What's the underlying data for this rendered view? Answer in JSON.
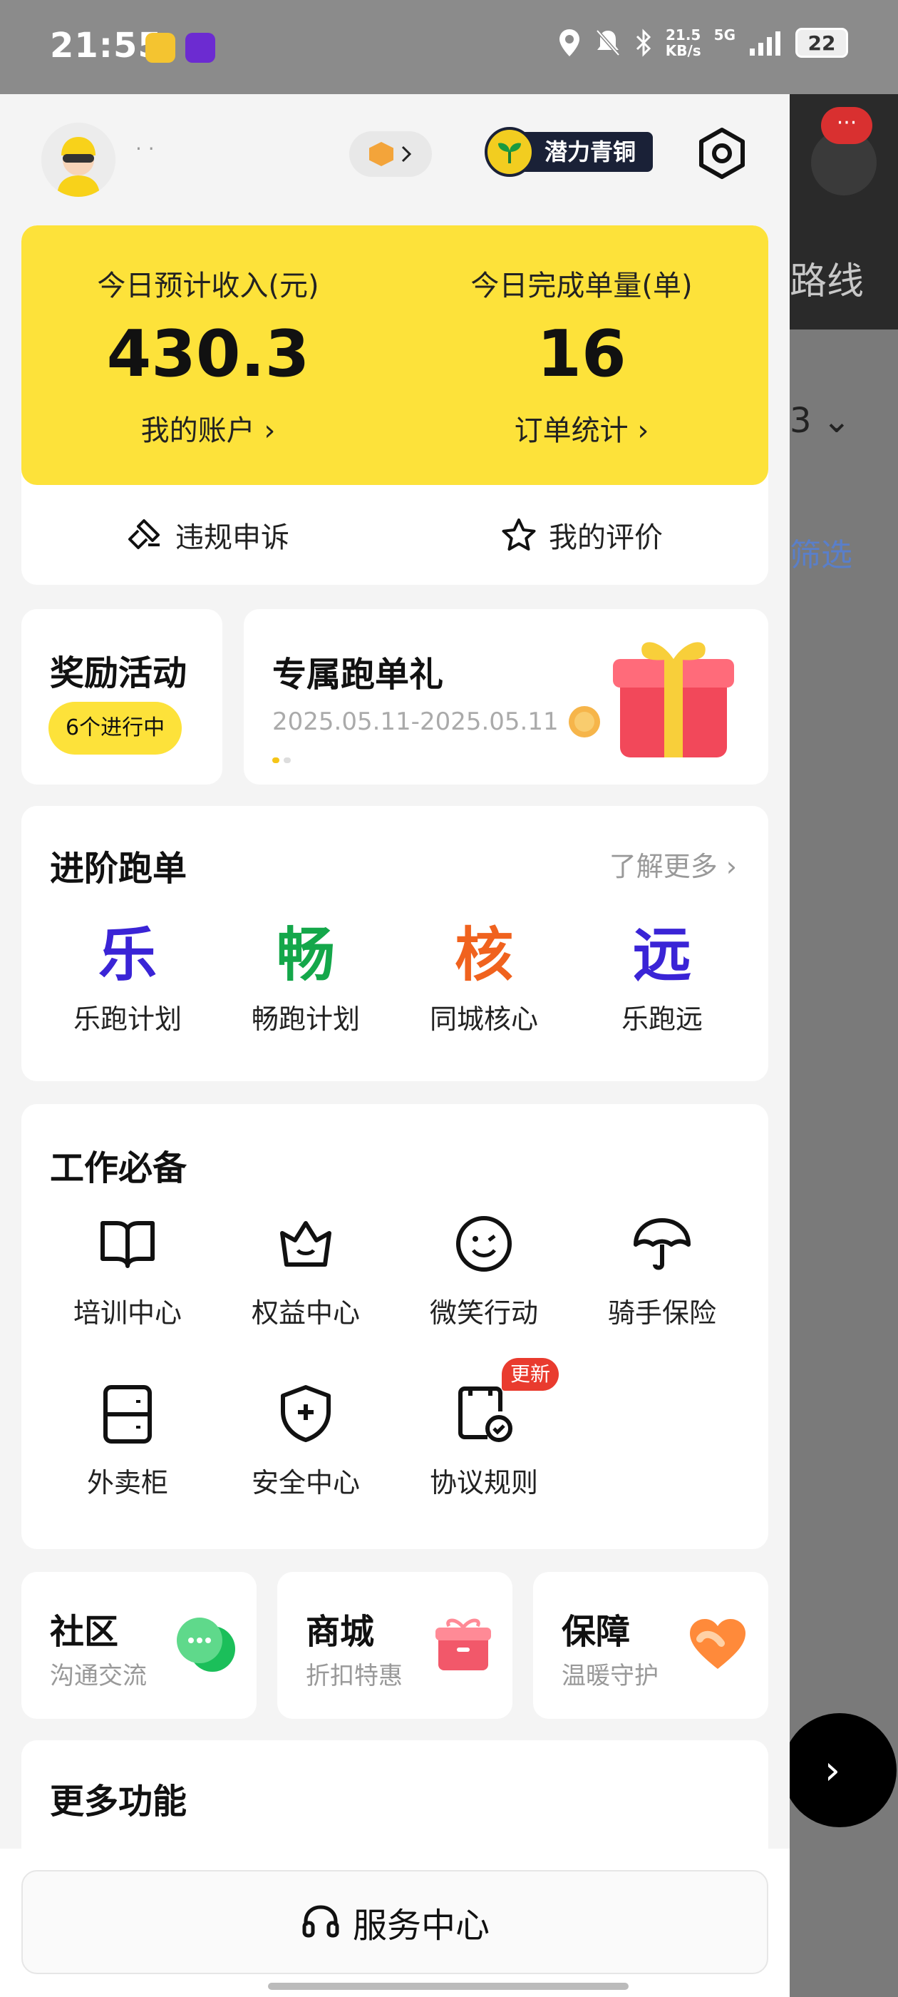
{
  "status_bar": {
    "time": "21:55",
    "net_speed_value": "21.5",
    "net_speed_unit": "KB/s",
    "network": "5G",
    "battery": "22"
  },
  "header": {
    "username": "· ·",
    "level_label": "潜力青铜"
  },
  "earnings": {
    "income_title": "今日预计收入(元)",
    "income_value": "430.3",
    "income_link": "我的账户 ›",
    "orders_title": "今日完成单量(单)",
    "orders_value": "16",
    "orders_link": "订单统计 ›",
    "appeal_label": "违规申诉",
    "review_label": "我的评价"
  },
  "reward": {
    "title": "奖励活动",
    "badge": "6个进行中"
  },
  "gift": {
    "title": "专属跑单礼",
    "dates": "2025.05.11-2025.05.11"
  },
  "advanced": {
    "title": "进阶跑单",
    "more": "了解更多 ›",
    "items": [
      {
        "glyph": "乐",
        "label": "乐跑计划",
        "color": "#3a24d6"
      },
      {
        "glyph": "畅",
        "label": "畅跑计划",
        "color": "#14a74a"
      },
      {
        "glyph": "核",
        "label": "同城核心",
        "color": "#f0621e"
      },
      {
        "glyph": "远",
        "label": "乐跑远",
        "color": "#3a24d6"
      }
    ]
  },
  "work": {
    "title": "工作必备",
    "row1": [
      {
        "label": "培训中心",
        "icon": "book-icon"
      },
      {
        "label": "权益中心",
        "icon": "crown-icon"
      },
      {
        "label": "微笑行动",
        "icon": "smile-icon"
      },
      {
        "label": "骑手保险",
        "icon": "umbrella-icon"
      }
    ],
    "row2": [
      {
        "label": "外卖柜",
        "icon": "cabinet-icon"
      },
      {
        "label": "安全中心",
        "icon": "shield-icon"
      },
      {
        "label": "协议规则",
        "icon": "agreement-icon",
        "badge": "更新"
      }
    ]
  },
  "tiles": [
    {
      "title": "社区",
      "sub": "沟通交流",
      "icon": "chat-bubble-icon"
    },
    {
      "title": "商城",
      "sub": "折扣特惠",
      "icon": "gift-box-icon"
    },
    {
      "title": "保障",
      "sub": "温暖守护",
      "icon": "heart-icon"
    }
  ],
  "more_functions": {
    "title": "更多功能"
  },
  "service": {
    "label": "服务中心"
  },
  "background": {
    "route_text": "路线",
    "filter_text": "筛选",
    "dropdown_text": "3 ⌄",
    "badge_text": "···",
    "arrow": "›"
  }
}
